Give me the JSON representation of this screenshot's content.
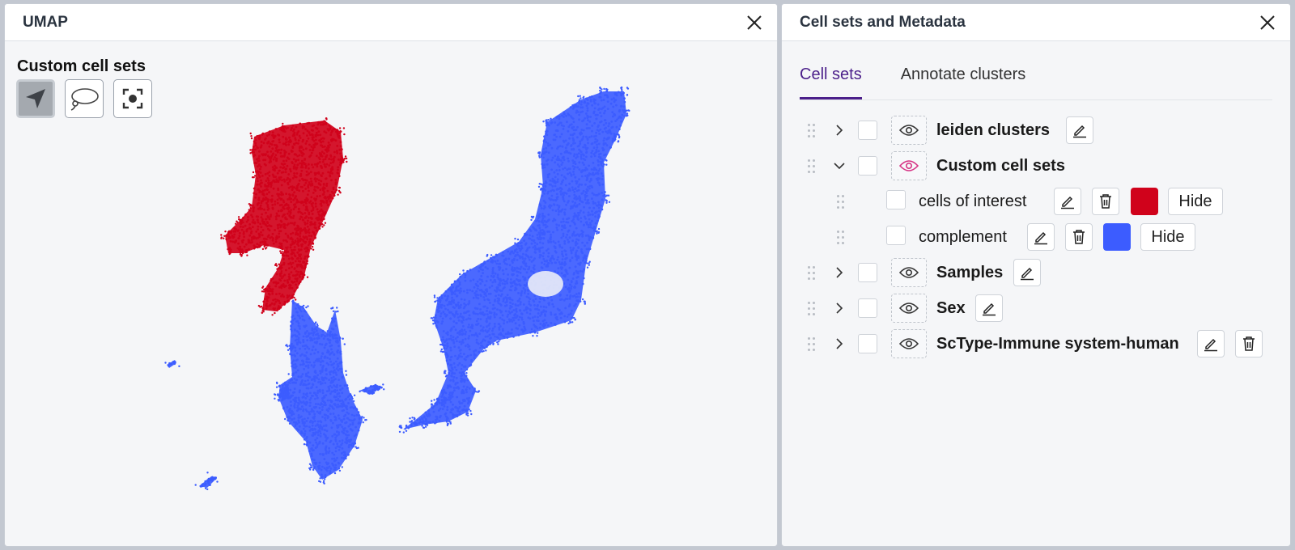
{
  "umap_panel": {
    "title": "UMAP",
    "tool_label": "Custom cell sets",
    "tools": [
      "navigate-arrow-icon",
      "lasso-icon",
      "recenter-icon"
    ]
  },
  "cellsets_panel": {
    "title": "Cell sets and Metadata",
    "tabs": [
      {
        "label": "Cell sets",
        "active": true
      },
      {
        "label": "Annotate clusters",
        "active": false
      }
    ],
    "groups": {
      "leiden": {
        "label": "leiden clusters",
        "expanded": false
      },
      "custom": {
        "label": "Custom cell sets",
        "expanded": true,
        "children": [
          {
            "label": "cells of interest",
            "color": "#d0021b",
            "hide_label": "Hide"
          },
          {
            "label": "complement",
            "color": "#3c5cff",
            "hide_label": "Hide"
          }
        ]
      },
      "samples": {
        "label": "Samples",
        "expanded": false
      },
      "sex": {
        "label": "Sex",
        "expanded": false
      },
      "sctype": {
        "label": "ScType-Immune system-human",
        "expanded": false
      }
    }
  },
  "colors": {
    "cells_of_interest": "#d0021b",
    "complement": "#3c5cff",
    "accent": "#4b1f8a",
    "active_eye": "#d63384"
  }
}
